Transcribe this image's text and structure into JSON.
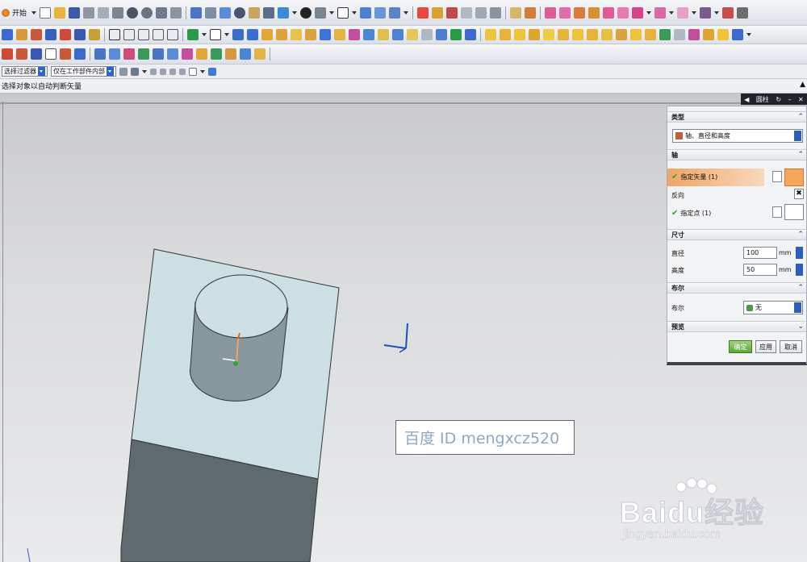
{
  "toolbar": {
    "start_label": "开始",
    "selection_filter": "选择过滤器",
    "assembly_scope": "仅在工作部件内部",
    "status_prompt": "选择对象以自动判断矢量",
    "right_marker": "▲"
  },
  "viewport": {
    "watermark_text": "百度 ID mengxcz520",
    "brand_logo_text": "Baidu经验",
    "brand_site": "jingyan.baidu.com"
  },
  "dialog": {
    "title_bar_label": "圆柱",
    "sections": {
      "type": "类型",
      "axis": "轴",
      "dimensions": "尺寸",
      "boolean": "布尔",
      "preview": "预览"
    },
    "type_value": "轴、直径和高度",
    "axis": {
      "specify_vector": "指定矢量 (1)",
      "reverse": "反向",
      "specify_point": "指定点 (1)"
    },
    "dimensions": {
      "diameter_label": "直径",
      "diameter_value": "100",
      "height_label": "高度",
      "height_value": "50",
      "unit": "mm"
    },
    "boolean": {
      "label": "布尔",
      "value": "无"
    },
    "buttons": {
      "ok": "确定",
      "apply": "应用",
      "cancel": "取消"
    }
  },
  "colors": {
    "slab_top": "#ccdfe3",
    "slab_side": "#5f6a6e",
    "cylinder_side": "#87999e",
    "cylinder_top": "#cfe0e4",
    "highlight_row": "#f0a566",
    "ok_button": "#69b84a",
    "axis_blue": "#1f4fbf"
  }
}
